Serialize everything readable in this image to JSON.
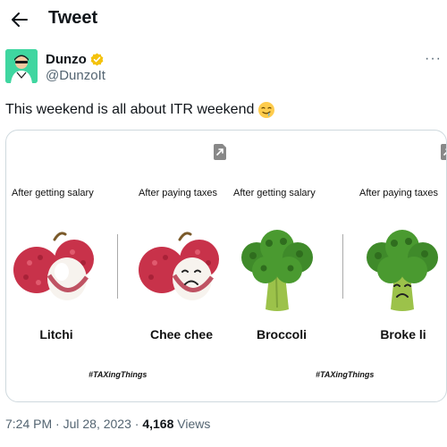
{
  "header": {
    "title": "Tweet",
    "back_icon": "arrow-left-icon"
  },
  "author": {
    "display_name": "Dunzo",
    "handle": "@DunzoIt",
    "verified_color": "#f4c20d",
    "avatar_color": "#3fd6a0"
  },
  "more_icon": "more-horizontal-icon",
  "more_label": "···",
  "tweet": {
    "text": "This weekend is all about ITR weekend",
    "emoji": "drooling-face-emoji"
  },
  "media": {
    "panels": [
      {
        "left": {
          "caption": "After getting salary",
          "name": "Litchi"
        },
        "right": {
          "caption": "After paying taxes",
          "name": "Chee chee"
        },
        "hashtag": "#TAXingThings"
      },
      {
        "left": {
          "caption": "After getting salary",
          "name": "Broccoli"
        },
        "right": {
          "caption": "After paying taxes",
          "name": "Broke li"
        },
        "hashtag": "#TAXingThings"
      }
    ]
  },
  "meta": {
    "time": "7:24 PM",
    "date": "Jul 28, 2023",
    "separator": "·",
    "views_count": "4,168",
    "views_label": "Views"
  }
}
